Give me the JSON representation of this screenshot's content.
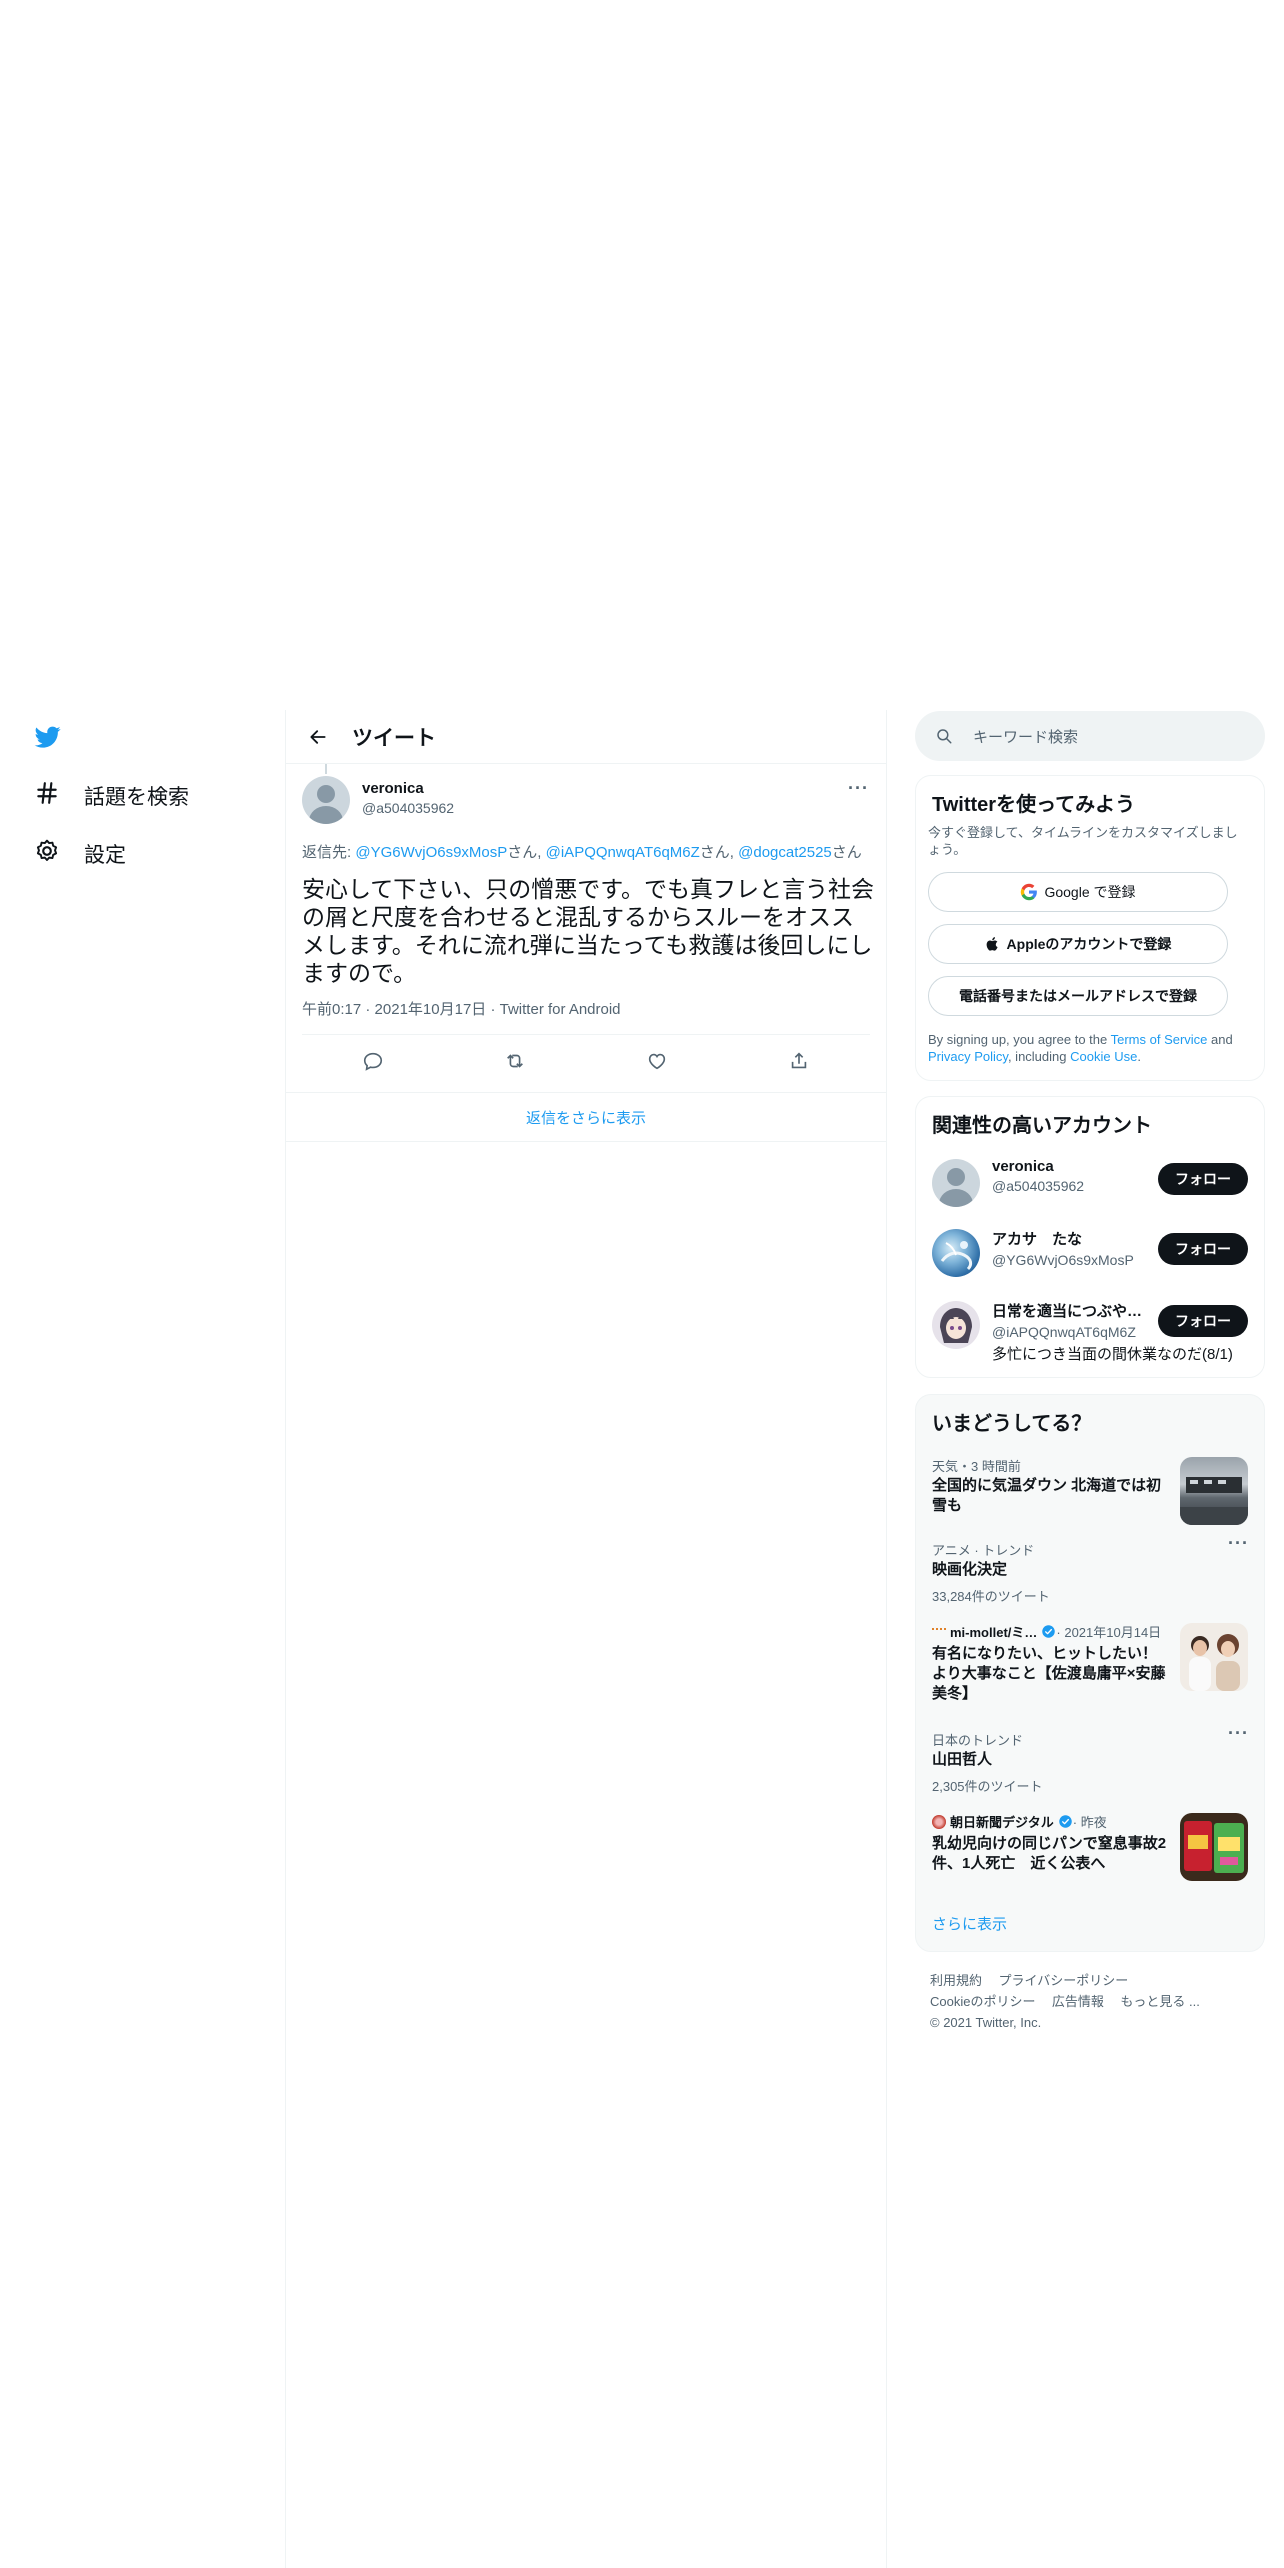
{
  "nav": {
    "items": [
      {
        "label": "話題を検索",
        "icon": "hashtag-icon"
      },
      {
        "label": "設定",
        "icon": "gear-icon"
      }
    ]
  },
  "header": {
    "title": "ツイート"
  },
  "tweet": {
    "author_name": "veronica",
    "author_handle": "@a504035962",
    "reply_prefix": "返信先: ",
    "reply_to": [
      {
        "handle": "@YG6WvjO6s9xMosP",
        "suffix": "さん, "
      },
      {
        "handle": "@iAPQQnwqAT6qM6Z",
        "suffix": "さん, "
      },
      {
        "handle": "@dogcat2525",
        "suffix": "さん"
      }
    ],
    "text": "安心して下さい、只の憎悪です。でも真フレと言う社会の屑と尺度を合わせると混乱するからスルーをオススメします。それに流れ弾に当たっても救護は後回しにしますので。",
    "time": "午前0:17",
    "date": "2021年10月17日",
    "source": "Twitter for Android",
    "sep": "·",
    "more_replies": "返信をさらに表示"
  },
  "search": {
    "placeholder": "キーワード検索"
  },
  "signup": {
    "title": "Twitterを使ってみよう",
    "subtitle": "今すぐ登録して、タイムラインをカスタマイズしましょう。",
    "google_label": "Google で登録",
    "apple_label": "Appleのアカウントで登録",
    "phone_label": "電話番号またはメールアドレスで登録",
    "terms_1": "By signing up, you agree to the ",
    "terms_link": "Terms of Service",
    "terms_2": " and ",
    "privacy_link": "Privacy Policy",
    "terms_3": ", including ",
    "cookie_link": "Cookie Use",
    "terms_4": "."
  },
  "related": {
    "title": "関連性の高いアカウント",
    "follow_label": "フォロー",
    "accounts": [
      {
        "name": "veronica",
        "handle": "@a504035962",
        "bio": ""
      },
      {
        "name": "アカサ　たな",
        "handle": "@YG6WvjO6s9xMosP",
        "bio": ""
      },
      {
        "name": "日常を適当につぶや…",
        "handle": "@iAPQQnwqAT6qM6Z",
        "bio": "多忙につき当面の間休業なのだ(8/1)"
      }
    ]
  },
  "trends": {
    "title": "いまどうしてる？",
    "items": [
      {
        "meta": "天気・3 時間前",
        "title": "全国的に気温ダウン 北海道では初雪も",
        "count": ""
      },
      {
        "meta": "アニメ · トレンド",
        "title": "映画化決定",
        "count": "33,284件のツイート"
      },
      {
        "meta_name": "mi-mollet/ミ…",
        "meta_date": " · 2021年10月14日",
        "title": "有名になりたい、ヒットしたい！より大事なこと【佐渡島庸平×安藤美冬】",
        "count": ""
      },
      {
        "meta": "日本のトレンド",
        "title": "山田哲人",
        "count": "2,305件のツイート"
      },
      {
        "meta_name": "朝日新聞デジタル",
        "meta_date": " · 昨夜",
        "title": "乳幼児向けの同じパンで窒息事故2件、1人死亡　近く公表へ",
        "count": ""
      }
    ],
    "show_more": "さらに表示"
  },
  "footer": {
    "links": [
      "利用規約",
      "プライバシーポリシー",
      "Cookieのポリシー",
      "広告情報",
      "もっと見る ..."
    ],
    "copyright": "© 2021 Twitter, Inc."
  },
  "colors": {
    "accent": "#1d9bf0",
    "text": "#0f1419",
    "muted": "#536471",
    "border": "#eff3f4"
  }
}
